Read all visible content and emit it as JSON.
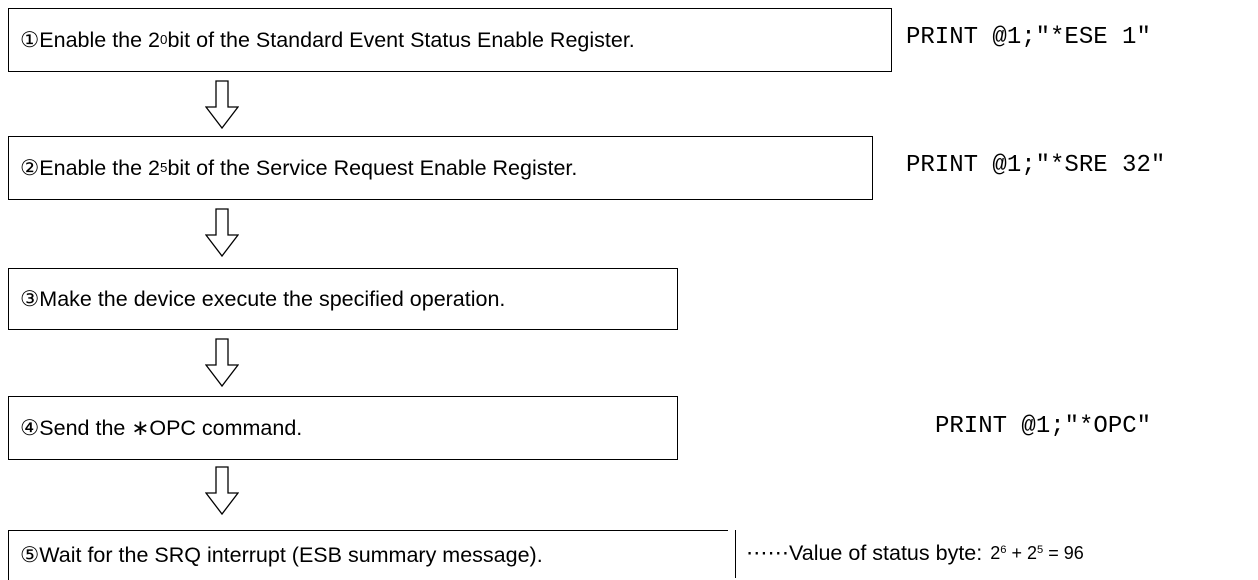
{
  "steps": [
    {
      "marker": "①",
      "before": " Enable the 2",
      "sup": "0",
      "after": " bit of the Standard Event Status Enable Register.",
      "command": "PRINT @1;\"*ESE 1\""
    },
    {
      "marker": "②",
      "before": " Enable the 2",
      "sup": "5",
      "after": " bit of the Service Request Enable Register.",
      "command": "PRINT @1;\"*SRE 32\""
    },
    {
      "marker": "③",
      "text": " Make the device execute the specified operation."
    },
    {
      "marker": "④",
      "text": " Send the ∗OPC command.",
      "command": "PRINT @1;\"*OPC\""
    },
    {
      "marker": "⑤",
      "text": " Wait for the SRQ interrupt (ESB summary message)."
    }
  ],
  "status_note": {
    "dots": "⋯⋯",
    "label": " Value of status byte:",
    "base1": "2",
    "exp1": "6",
    "plus": " + ",
    "base2": "2",
    "exp2": "5",
    "result": " = 96"
  },
  "icons": {
    "flow_arrow": "down-arrow-icon"
  }
}
